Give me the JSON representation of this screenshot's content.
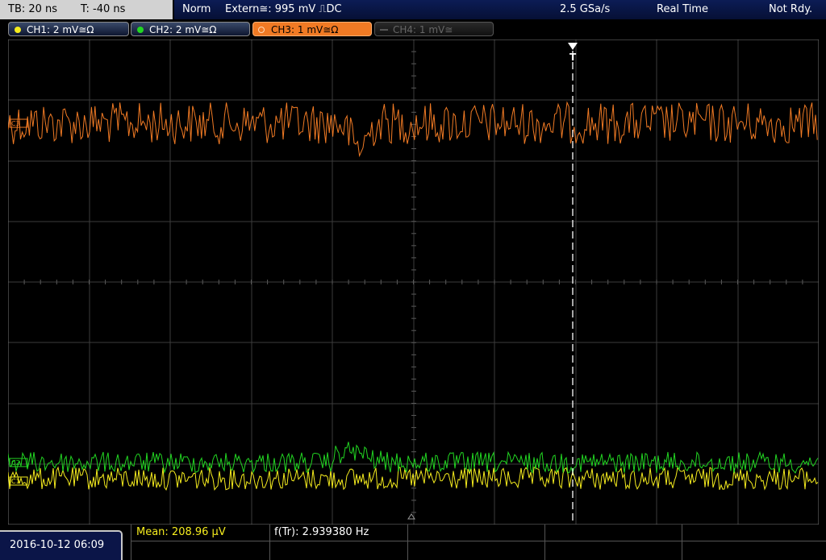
{
  "status": {
    "timebase": "TB: 20 ns",
    "trigger_time": "T: -40 ns",
    "mode": "Norm",
    "trigger_info": "Extern≅: 995 mV ⎍DC",
    "sample_rate": "2.5 GSa/s",
    "acq_mode": "Real Time",
    "state": "Not Rdy."
  },
  "channels": [
    {
      "label": "CH1: 2 mV≅Ω",
      "color": "#f5ec1e"
    },
    {
      "label": "CH2: 2 mV≅Ω",
      "color": "#22d622"
    },
    {
      "label": "CH3: 1 mV≅Ω",
      "color": "#f07a24"
    },
    {
      "label": "CH4: 1 mV≅",
      "color": "#555555"
    }
  ],
  "markers": {
    "ch3_marker": "C3",
    "ch2_marker": "C2",
    "ch1_marker": "C1",
    "trigger_label": "T"
  },
  "measurements": {
    "mean": "Mean: 208.96 µV",
    "frequency": "f(Tr): 2.939380 Hz"
  },
  "datetime": "2016-10-12 06:09",
  "colors": {
    "ch1": "#f5ec1e",
    "ch2": "#22d622",
    "ch3": "#f07a24",
    "grid": "#3c3c3c",
    "status_bar": "#061035"
  }
}
